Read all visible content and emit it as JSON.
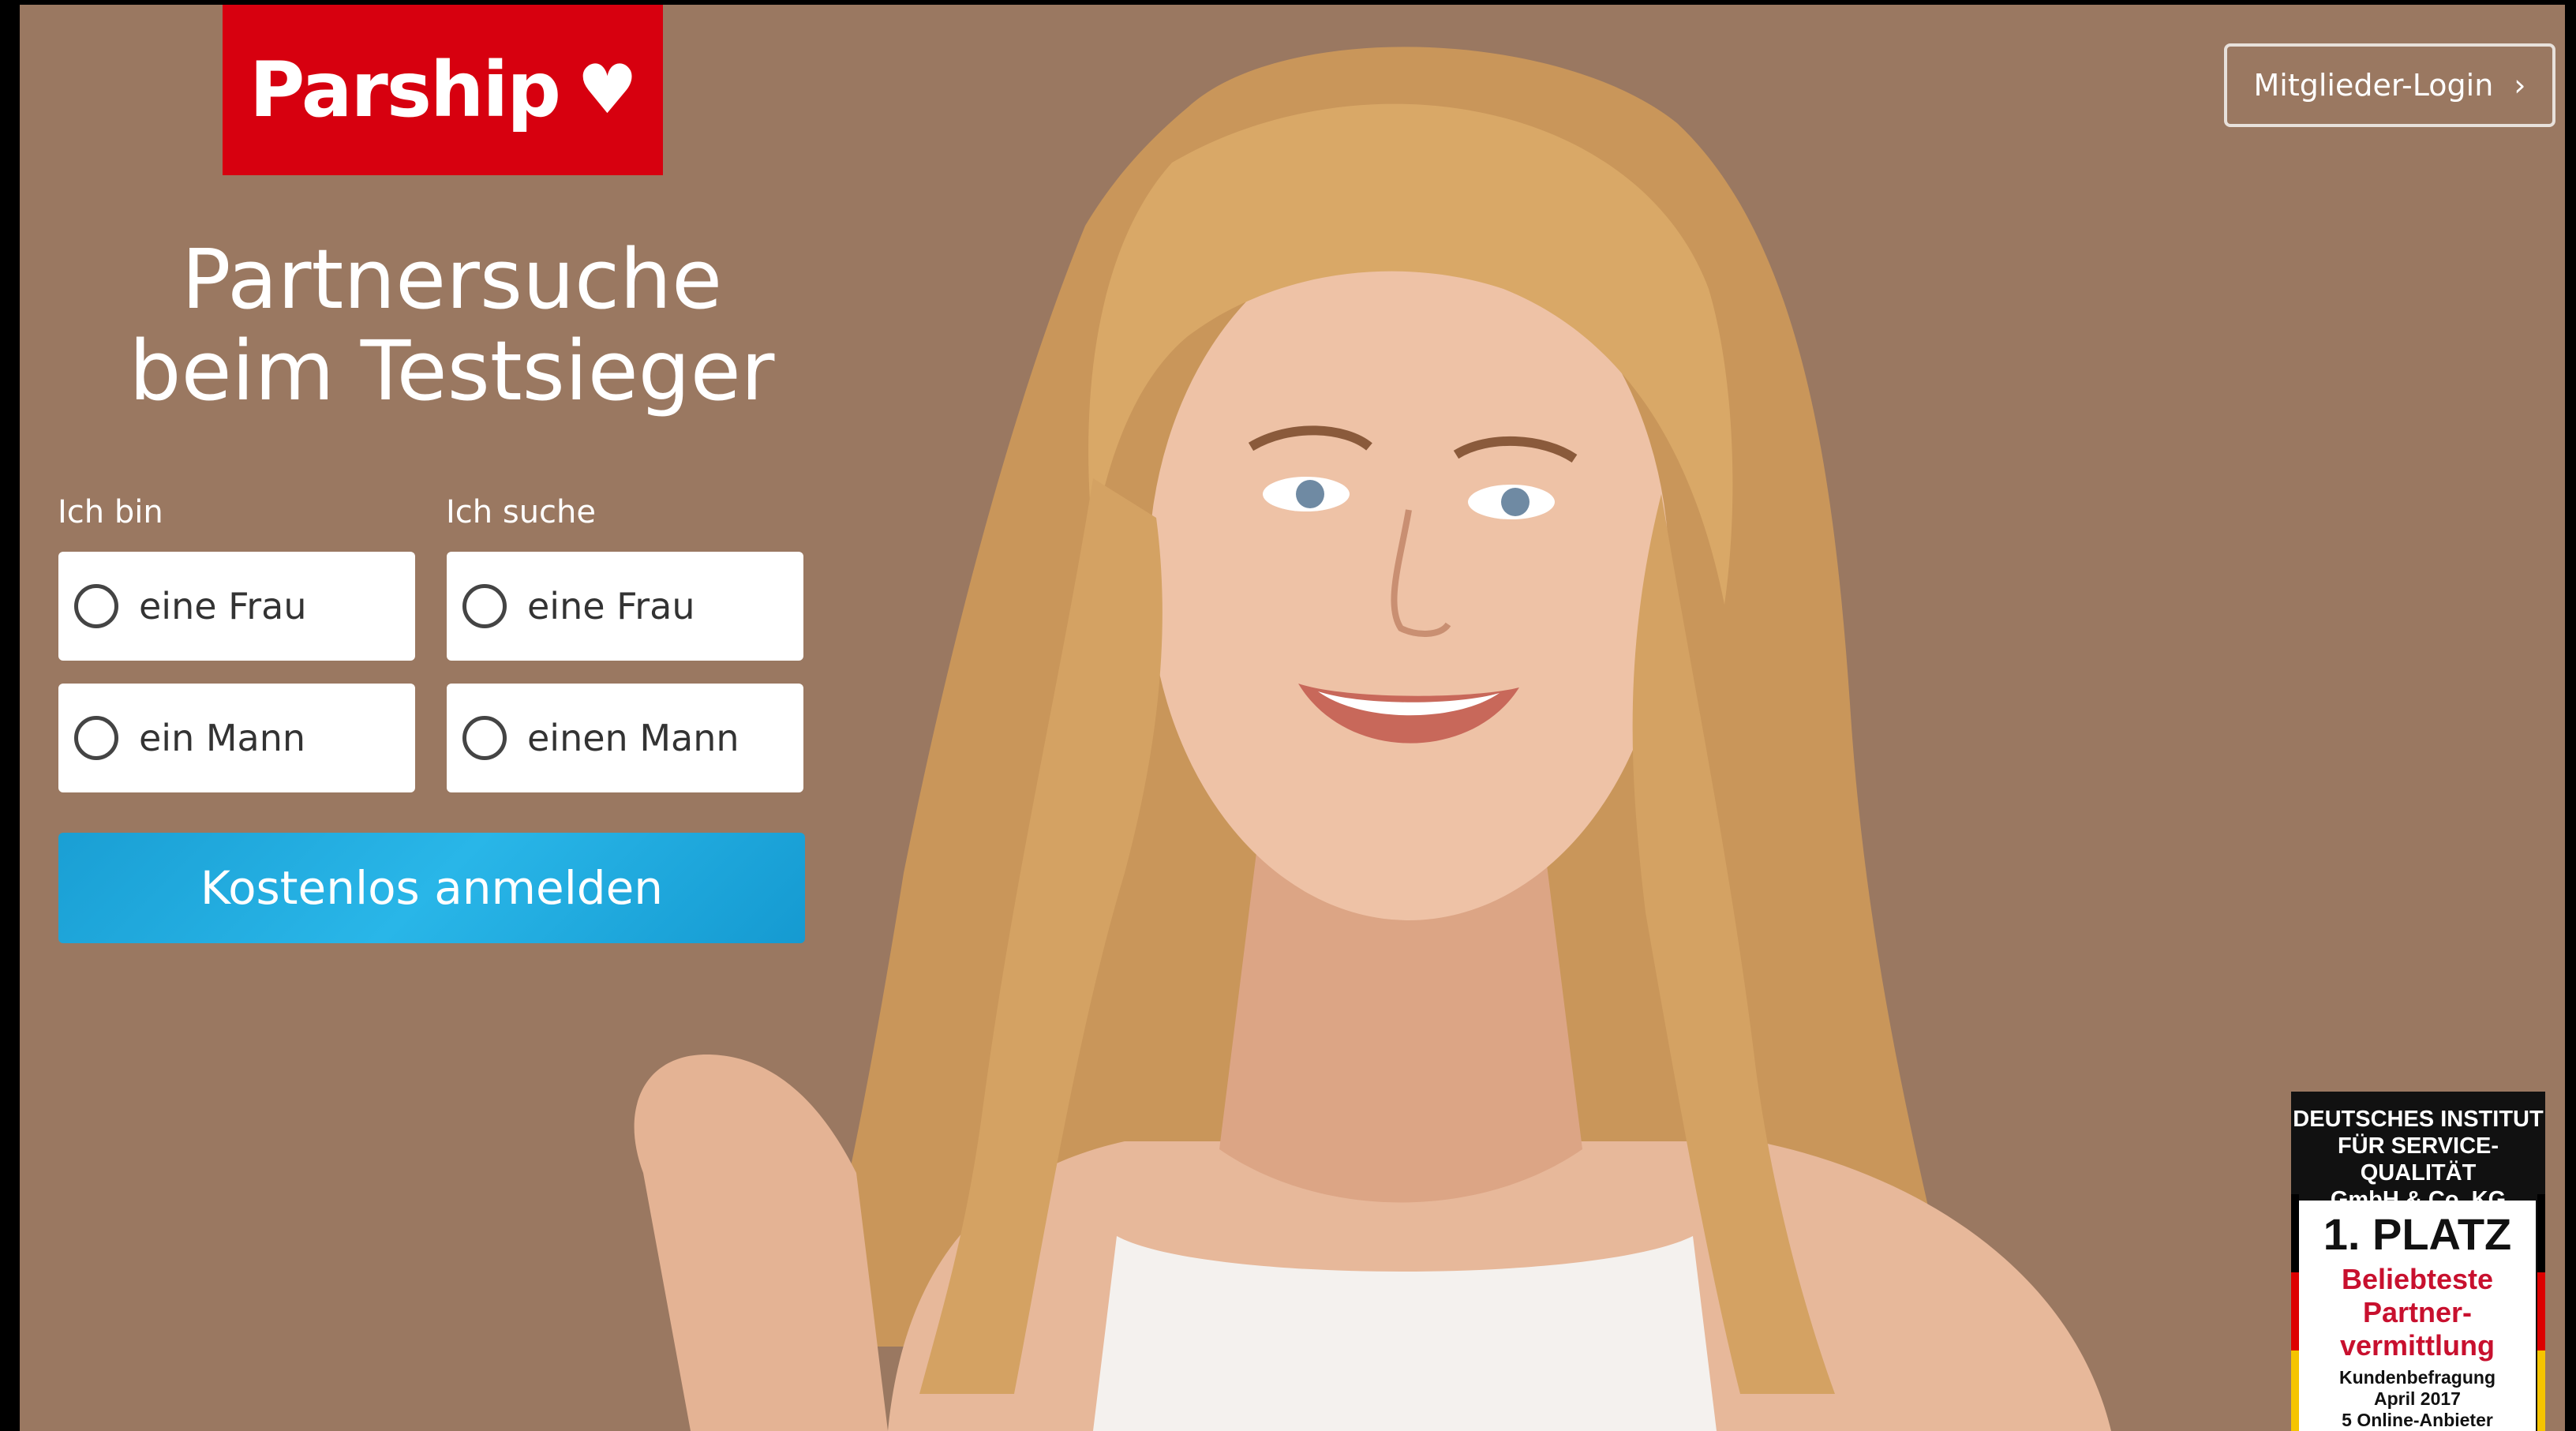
{
  "brand": {
    "name": "Parship",
    "heart": "♥",
    "color": "#d7000f"
  },
  "header": {
    "login_label": "Mitglieder-Login",
    "login_chevron": "›"
  },
  "hero": {
    "headline_line1": "Partnersuche",
    "headline_line2": "beim Testsieger",
    "background": "#9a7861"
  },
  "form": {
    "i_am_label": "Ich bin",
    "seeking_label": "Ich suche",
    "i_am_options": [
      "eine Frau",
      "ein Mann"
    ],
    "seeking_options": [
      "eine Frau",
      "einen Mann"
    ],
    "submit_label": "Kostenlos anmelden",
    "submit_color": "#1ea8de"
  },
  "seal": {
    "line1": "DEUTSCHES INSTITUT",
    "line2": "FÜR SERVICE-QUALITÄT",
    "line3": "GmbH & Co. KG",
    "place": "1. PLATZ",
    "award1": "Beliebteste",
    "award2": "Partner-",
    "award3": "vermittlung",
    "note1": "Kundenbefragung",
    "note2": "April 2017",
    "note3": "5 Online-Anbieter"
  }
}
